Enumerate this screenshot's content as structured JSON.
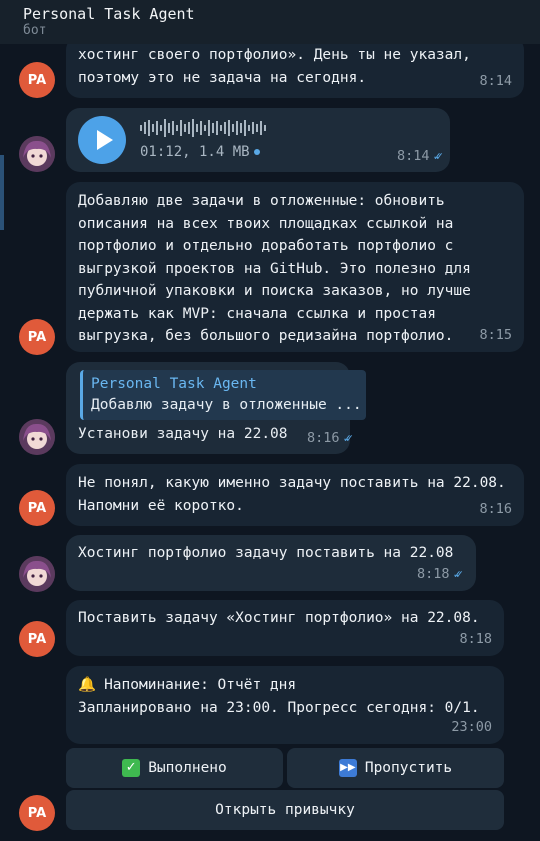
{
  "header": {
    "title": "Personal Task Agent",
    "subtitle": "бот"
  },
  "avatars": {
    "bot_initials": "PA"
  },
  "messages": {
    "m1": {
      "line1": "хостинг своего портфолио». День ты не указал,",
      "line2": "поэтому это не задача на сегодня.",
      "time": "8:14"
    },
    "voice": {
      "duration_size": "01:12, 1.4 MB",
      "time": "8:14"
    },
    "m3": {
      "lines": [
        "Добавляю две задачи в отложенные: обновить",
        "описания на всех твоих площадках ссылкой на",
        "портфолио и отдельно доработать портфолио с",
        "выгрузкой проектов на GitHub. Это полезно для",
        "публичной упаковки и поиска заказов, но лучше",
        "держать как MVP: сначала ссылка и простая",
        "выгрузка, без большого редизайна портфолио."
      ],
      "time": "8:15"
    },
    "m4": {
      "reply_name": "Personal Task Agent",
      "reply_text": "Добавлю задачу в отложенные ...",
      "text": "Установи задачу на 22.08",
      "time": "8:16"
    },
    "m5": {
      "line1": "Не понял, какую именно задачу поставить на 22.08.",
      "line2": "Напомни её коротко.",
      "time": "8:16"
    },
    "m6": {
      "text": "Хостинг портфолио задачу поставить на 22.08",
      "time": "8:18"
    },
    "m7": {
      "text": "Поставить задачу «Хостинг портфолио» на 22.08.",
      "time": "8:18"
    },
    "m8": {
      "line1": "Напоминание: Отчёт дня",
      "line2": "Запланировано на 23:00. Прогресс сегодня: 0/1.",
      "time": "23:00"
    }
  },
  "keyboard": {
    "done": "Выполнено",
    "skip": "Пропустить",
    "open_habit": "Открыть привычку"
  },
  "colors": {
    "accent": "#5aa9e6",
    "bot_avatar": "#e05a3a",
    "bubble": "#182533",
    "background": "#0e1621"
  }
}
